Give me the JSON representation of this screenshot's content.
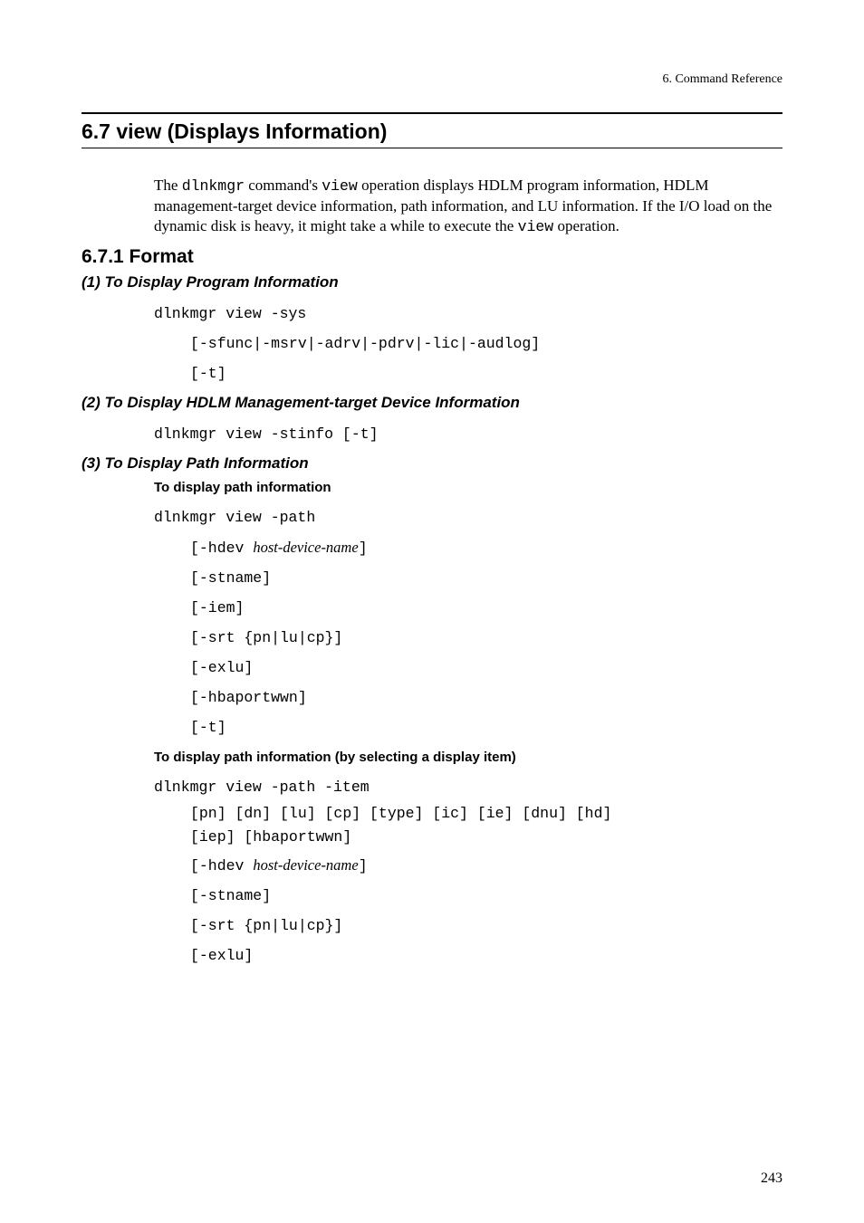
{
  "running_head": "6.  Command Reference",
  "section_title": "6.7  view (Displays Information)",
  "intro": {
    "t1": "The ",
    "cmd": "dlnkmgr",
    "t2": " command's ",
    "op": "view",
    "t3": " operation displays HDLM program information, HDLM management-target device information, path information, and LU information. If the I/O load on the dynamic disk is heavy, it might take a while to execute the ",
    "op2": "view",
    "t4": " operation."
  },
  "subsection_title": "6.7.1  Format",
  "sub1": {
    "title": "(1)  To Display Program Information",
    "line1": "dlnkmgr view -sys",
    "line2": "[-sfunc|-msrv|-adrv|-pdrv|-lic|-audlog]",
    "line3": "[-t]"
  },
  "sub2": {
    "title": "(2)  To Display HDLM Management-target Device Information",
    "line1": "dlnkmgr view -stinfo [-t]"
  },
  "sub3": {
    "title": "(3)  To Display Path Information",
    "heading_a": "To display path information",
    "a_line1": "dlnkmgr view -path",
    "a_line2_pre": "[-hdev ",
    "a_line2_it": "host-device-name",
    "a_line2_post": "]",
    "a_line3": "[-stname]",
    "a_line4": "[-iem]",
    "a_line5": "[-srt {pn|lu|cp}]",
    "a_line6": "[-exlu]",
    "a_line7": "[-hbaportwwn]",
    "a_line8": "[-t]",
    "heading_b": "To display path information (by selecting a display item)",
    "b_line1": "dlnkmgr view -path -item",
    "b_line2": "[pn] [dn] [lu] [cp] [type] [ic] [ie] [dnu] [hd] [iep] [hbaportwwn]",
    "b_line3_pre": "[-hdev ",
    "b_line3_it": "host-device-name",
    "b_line3_post": "]",
    "b_line4": "[-stname]",
    "b_line5": "[-srt {pn|lu|cp}]",
    "b_line6": "[-exlu]"
  },
  "page_number": "243"
}
